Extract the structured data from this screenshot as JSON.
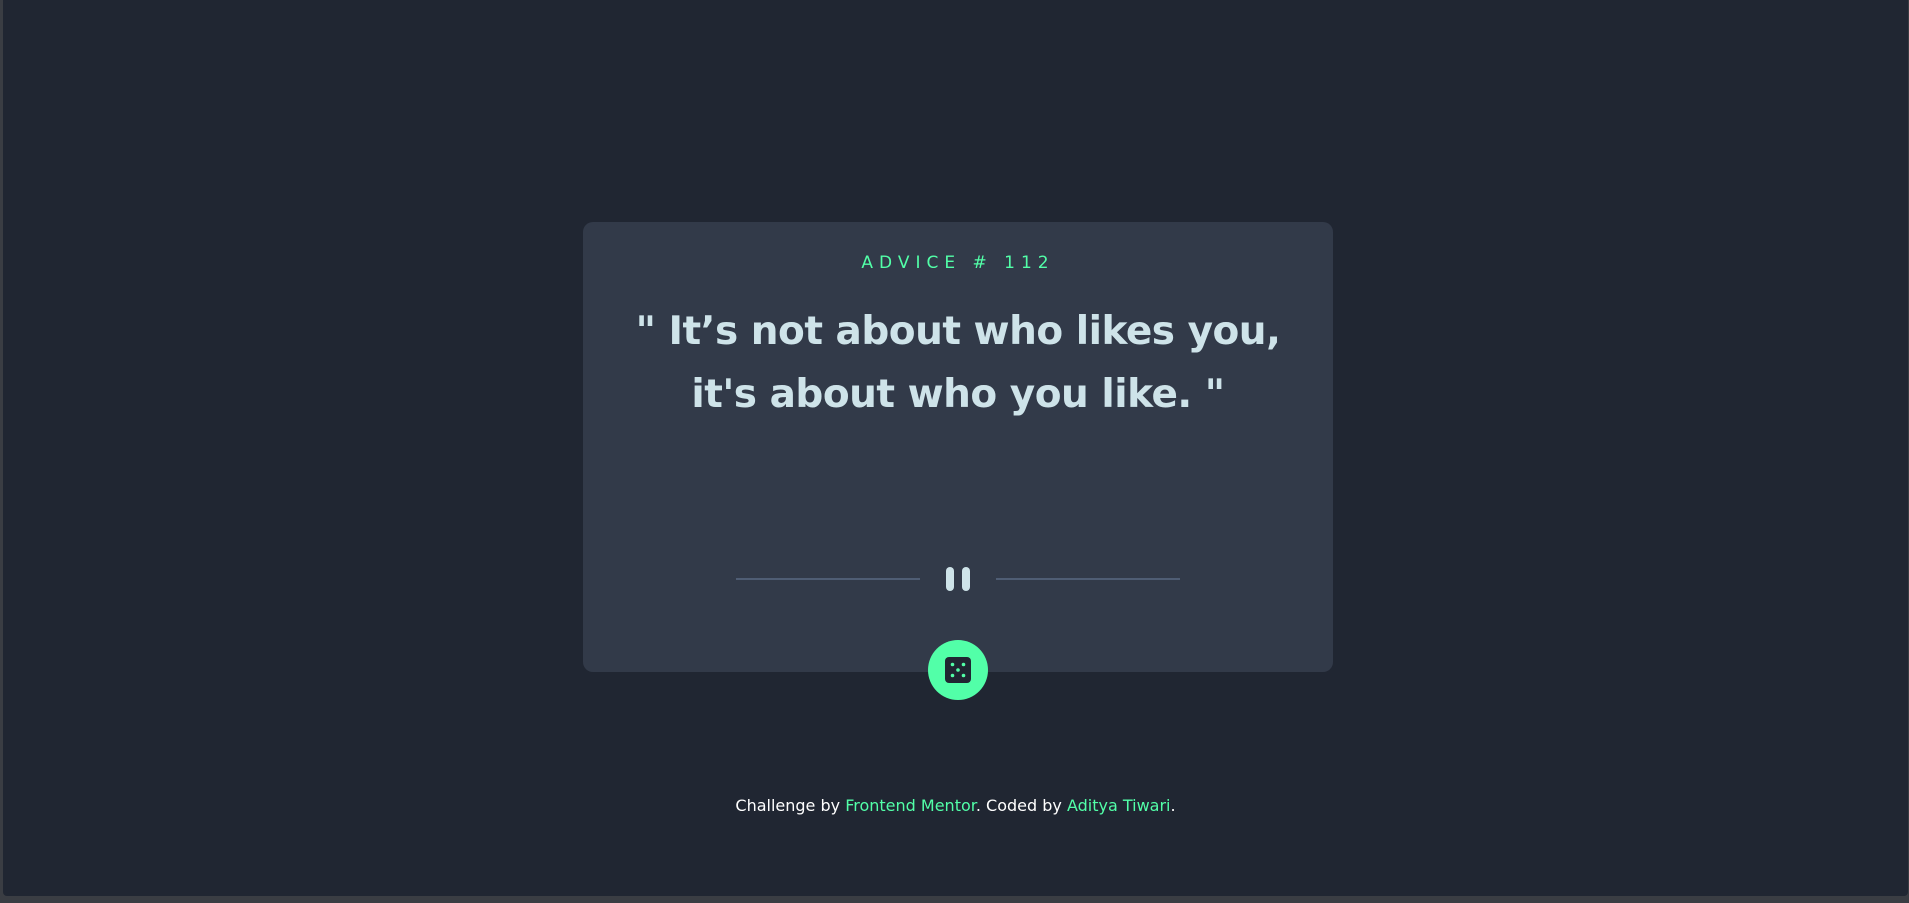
{
  "card": {
    "advice_label": "ADVICE # 112",
    "advice_text": "\" It’s not about who likes you, it's about who you like. \""
  },
  "icons": {
    "divider": "pause-quote-divider-icon",
    "dice": "dice-icon"
  },
  "footer": {
    "prefix": "Challenge by ",
    "link1": "Frontend Mentor",
    "middle": ". Coded by ",
    "link2": "Aditya Tiwari",
    "suffix": "."
  },
  "colors": {
    "background": "#202632",
    "card": "#323a49",
    "accent": "#52ffa8",
    "text": "#cee3e9",
    "divider": "#4f5d74"
  }
}
